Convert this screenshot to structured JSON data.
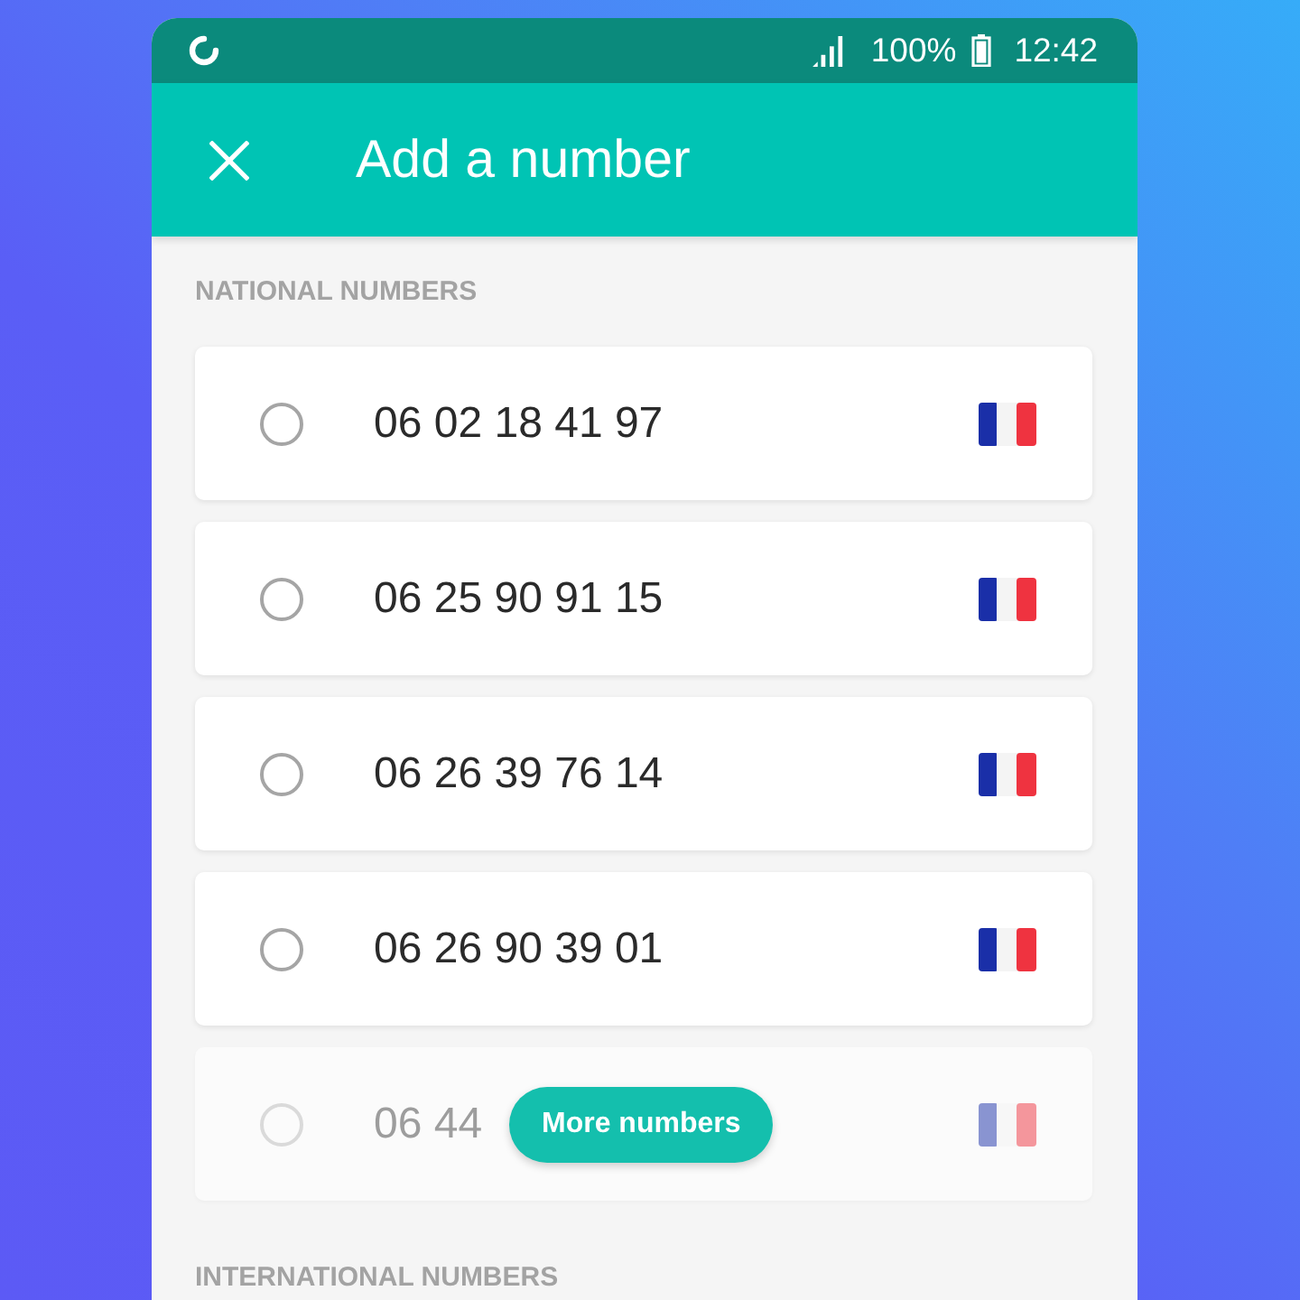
{
  "status_bar": {
    "battery": "100%",
    "time": "12:42"
  },
  "app_bar": {
    "title": "Add a number"
  },
  "sections": [
    {
      "heading": "NATIONAL NUMBERS",
      "numbers": [
        {
          "number": "06 02 18 41 97",
          "selected": false,
          "dimmed": false
        },
        {
          "number": "06 25 90 91 15",
          "selected": false,
          "dimmed": false
        },
        {
          "number": "06 26 39 76 14",
          "selected": false,
          "dimmed": false
        },
        {
          "number": "06 26 90 39 01",
          "selected": false,
          "dimmed": false
        },
        {
          "number": "06 44",
          "selected": false,
          "dimmed": true
        }
      ],
      "more_button": "More numbers"
    },
    {
      "heading": "INTERNATIONAL NUMBERS"
    }
  ]
}
